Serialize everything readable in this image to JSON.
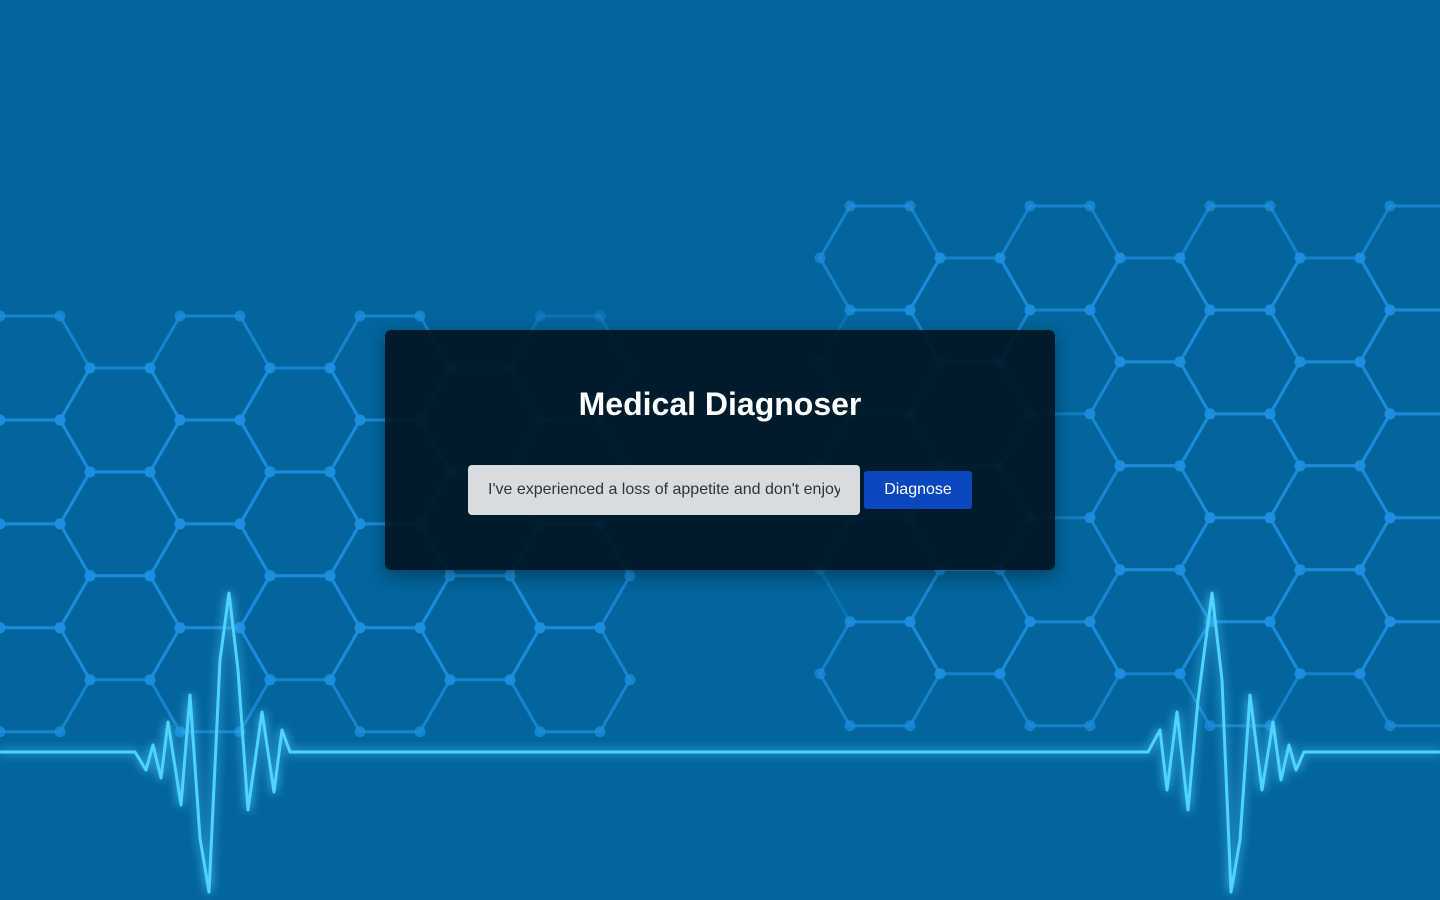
{
  "app": {
    "title": "Medical Diagnoser"
  },
  "form": {
    "symptom_value": "I've experienced a loss of appetite and don't enjoy",
    "diagnose_label": "Diagnose"
  },
  "background": {
    "icons": [
      "hexagon-network-icon",
      "heartbeat-line-icon"
    ]
  },
  "colors": {
    "background": "#02659c",
    "card": "#001520",
    "button": "#0a47bf",
    "input": "#d9dcde",
    "pulse": "#4fd3ff",
    "hexagon": "#1e8fe0"
  }
}
